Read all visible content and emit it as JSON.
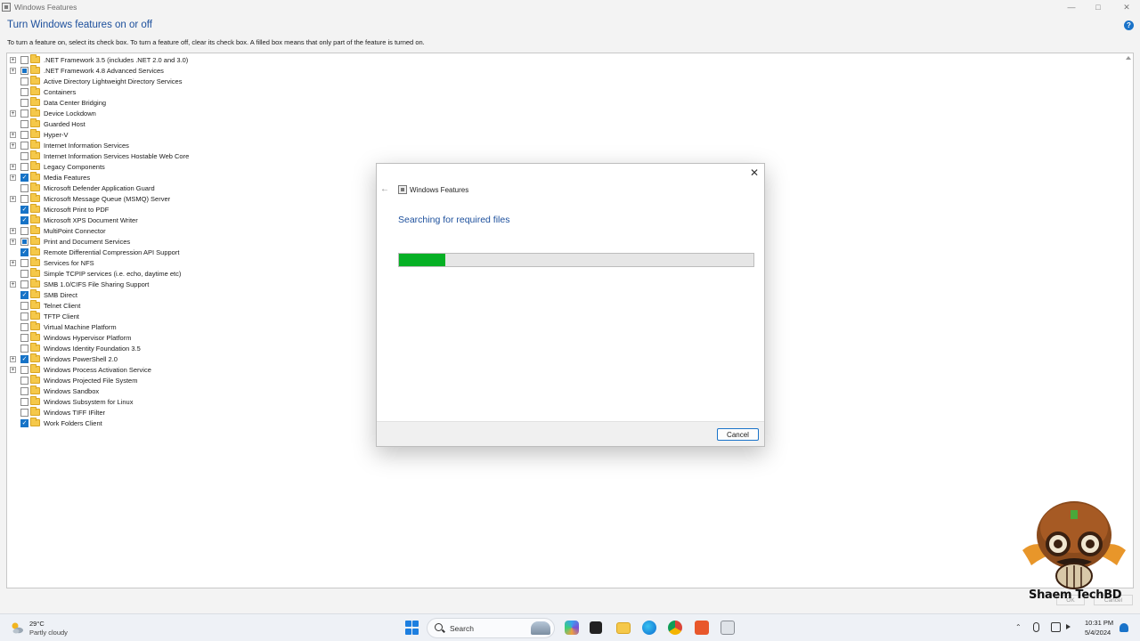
{
  "window": {
    "title": "Windows Features",
    "heading": "Turn Windows features on or off",
    "description": "To turn a feature on, select its check box. To turn a feature off, clear its check box. A filled box means that only part of the feature is turned on.",
    "controls": {
      "minimize": "—",
      "maximize": "□",
      "close": "✕"
    },
    "help_icon": "?"
  },
  "features": [
    {
      "label": ".NET Framework 3.5 (includes .NET 2.0 and 3.0)",
      "expandable": true,
      "state": "unchecked"
    },
    {
      "label": ".NET Framework 4.8 Advanced Services",
      "expandable": true,
      "state": "partial"
    },
    {
      "label": "Active Directory Lightweight Directory Services",
      "expandable": false,
      "state": "unchecked"
    },
    {
      "label": "Containers",
      "expandable": false,
      "state": "unchecked"
    },
    {
      "label": "Data Center Bridging",
      "expandable": false,
      "state": "unchecked"
    },
    {
      "label": "Device Lockdown",
      "expandable": true,
      "state": "unchecked"
    },
    {
      "label": "Guarded Host",
      "expandable": false,
      "state": "unchecked"
    },
    {
      "label": "Hyper-V",
      "expandable": true,
      "state": "unchecked"
    },
    {
      "label": "Internet Information Services",
      "expandable": true,
      "state": "unchecked"
    },
    {
      "label": "Internet Information Services Hostable Web Core",
      "expandable": false,
      "state": "unchecked"
    },
    {
      "label": "Legacy Components",
      "expandable": true,
      "state": "unchecked"
    },
    {
      "label": "Media Features",
      "expandable": true,
      "state": "checked"
    },
    {
      "label": "Microsoft Defender Application Guard",
      "expandable": false,
      "state": "unchecked"
    },
    {
      "label": "Microsoft Message Queue (MSMQ) Server",
      "expandable": true,
      "state": "unchecked"
    },
    {
      "label": "Microsoft Print to PDF",
      "expandable": false,
      "state": "checked"
    },
    {
      "label": "Microsoft XPS Document Writer",
      "expandable": false,
      "state": "checked"
    },
    {
      "label": "MultiPoint Connector",
      "expandable": true,
      "state": "unchecked"
    },
    {
      "label": "Print and Document Services",
      "expandable": true,
      "state": "partial"
    },
    {
      "label": "Remote Differential Compression API Support",
      "expandable": false,
      "state": "checked"
    },
    {
      "label": "Services for NFS",
      "expandable": true,
      "state": "unchecked"
    },
    {
      "label": "Simple TCPIP services (i.e. echo, daytime etc)",
      "expandable": false,
      "state": "unchecked"
    },
    {
      "label": "SMB 1.0/CIFS File Sharing Support",
      "expandable": true,
      "state": "unchecked"
    },
    {
      "label": "SMB Direct",
      "expandable": false,
      "state": "checked"
    },
    {
      "label": "Telnet Client",
      "expandable": false,
      "state": "unchecked"
    },
    {
      "label": "TFTP Client",
      "expandable": false,
      "state": "unchecked"
    },
    {
      "label": "Virtual Machine Platform",
      "expandable": false,
      "state": "unchecked"
    },
    {
      "label": "Windows Hypervisor Platform",
      "expandable": false,
      "state": "unchecked"
    },
    {
      "label": "Windows Identity Foundation 3.5",
      "expandable": false,
      "state": "unchecked"
    },
    {
      "label": "Windows PowerShell 2.0",
      "expandable": true,
      "state": "checked"
    },
    {
      "label": "Windows Process Activation Service",
      "expandable": true,
      "state": "unchecked"
    },
    {
      "label": "Windows Projected File System",
      "expandable": false,
      "state": "unchecked"
    },
    {
      "label": "Windows Sandbox",
      "expandable": false,
      "state": "unchecked"
    },
    {
      "label": "Windows Subsystem for Linux",
      "expandable": false,
      "state": "unchecked"
    },
    {
      "label": "Windows TIFF IFilter",
      "expandable": false,
      "state": "unchecked"
    },
    {
      "label": "Work Folders Client",
      "expandable": false,
      "state": "checked"
    }
  ],
  "dialog": {
    "title": "Windows Features",
    "status": "Searching for required files",
    "progress": 0.13,
    "cancel_label": "Cancel",
    "close_glyph": "✕",
    "back_glyph": "←"
  },
  "watermark": {
    "text": "Shaem TechBD"
  },
  "background_buttons": {
    "ok": "OK",
    "cancel": "Cancel"
  },
  "taskbar": {
    "weather_temp": "29°C",
    "weather_desc": "Partly cloudy",
    "search_label": "Search",
    "time": "10:31 PM",
    "date": "5/4/2024"
  },
  "colors": {
    "accent": "#1a73c9",
    "heading": "#1c4f9c",
    "progress_fill": "#06b025",
    "folder": "#f5c84a"
  }
}
